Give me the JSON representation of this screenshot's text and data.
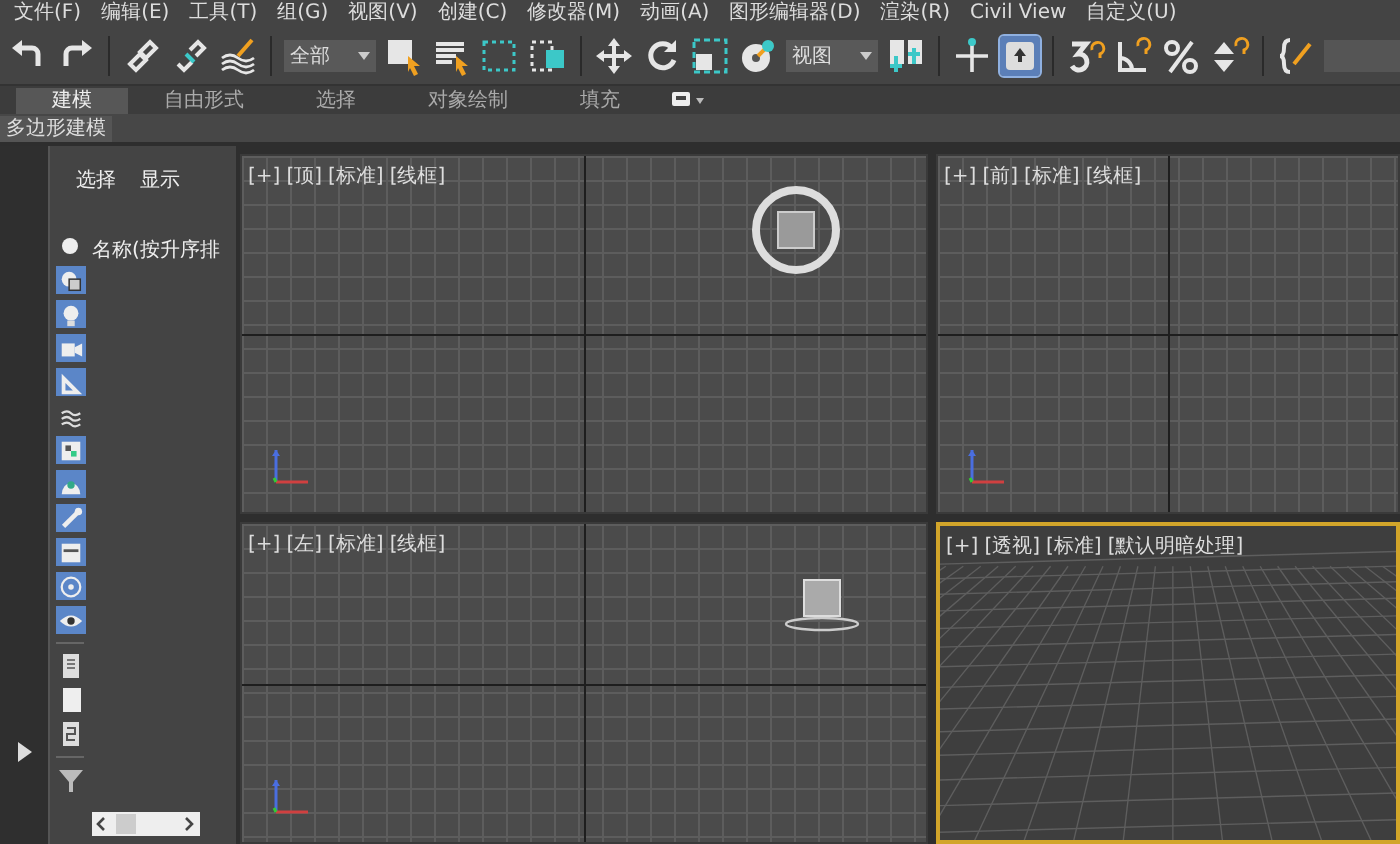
{
  "menu": [
    "文件(F)",
    "编辑(E)",
    "工具(T)",
    "组(G)",
    "视图(V)",
    "创建(C)",
    "修改器(M)",
    "动画(A)",
    "图形编辑器(D)",
    "渲染(R)",
    "Civil View",
    "自定义(U)"
  ],
  "toolbar": {
    "scene_dropdown": {
      "value": "全部"
    },
    "view_dropdown": {
      "value": "视图"
    },
    "manipulate_button": {
      "selected": true
    }
  },
  "ribbon_tabs": [
    {
      "label": "建模",
      "selected": true
    },
    {
      "label": "自由形式",
      "selected": false
    },
    {
      "label": "选择",
      "selected": false
    },
    {
      "label": "对象绘制",
      "selected": false
    },
    {
      "label": "填充",
      "selected": false
    }
  ],
  "ribbon_panel": {
    "label": "多边形建模"
  },
  "scene_explorer": {
    "tabs": [
      "选择",
      "显示"
    ],
    "column_header": "名称(按升序排",
    "filters": [
      {
        "on": true
      },
      {
        "on": true
      },
      {
        "on": true
      },
      {
        "on": true
      },
      {
        "on": false
      },
      {
        "on": true
      },
      {
        "on": true
      },
      {
        "on": true
      },
      {
        "on": true
      },
      {
        "on": true
      },
      {
        "on": true
      }
    ]
  },
  "viewports": [
    {
      "labels": [
        "[+]",
        "[顶]",
        "[标准]",
        "[线框]"
      ],
      "selected": false,
      "kind": "ortho"
    },
    {
      "labels": [
        "[+]",
        "[前]",
        "[标准]",
        "[线框]"
      ],
      "selected": false,
      "kind": "ortho"
    },
    {
      "labels": [
        "[+]",
        "[左]",
        "[标准]",
        "[线框]"
      ],
      "selected": false,
      "kind": "ortho"
    },
    {
      "labels": [
        "[+]",
        "[透视]",
        "[标准]",
        "[默认明暗处理]"
      ],
      "selected": true,
      "kind": "perspective"
    }
  ]
}
